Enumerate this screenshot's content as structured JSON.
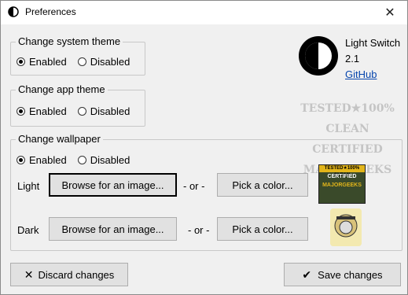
{
  "window": {
    "title": "Preferences"
  },
  "system_theme": {
    "legend": "Change system theme",
    "enabled_label": "Enabled",
    "disabled_label": "Disabled",
    "selected": "Enabled"
  },
  "app_theme": {
    "legend": "Change app theme",
    "enabled_label": "Enabled",
    "disabled_label": "Disabled",
    "selected": "Enabled"
  },
  "wallpaper": {
    "legend": "Change wallpaper",
    "enabled_label": "Enabled",
    "disabled_label": "Disabled",
    "selected": "Enabled",
    "light_label": "Light",
    "dark_label": "Dark",
    "browse_label": "Browse for an image...",
    "or_label": "- or -",
    "pick_color_label": "Pick a color..."
  },
  "app_info": {
    "name": "Light Switch",
    "version": "2.1",
    "link_text": "GitHub"
  },
  "watermark": {
    "line1": "TESTED★100% CLEAN",
    "line2": "CERTIFIED",
    "line3": "MAJORGEEKS",
    "badge_top": "TESTED★100% CLEAN",
    "badge_mid": "CERTIFIED",
    "badge_bot": "MAJORGEEKS"
  },
  "footer": {
    "discard_label": "Discard changes",
    "save_label": "Save changes"
  },
  "colors": {
    "window_bg": "#f0f0f0",
    "button_bg": "#e1e1e1",
    "link": "#0645ad"
  }
}
